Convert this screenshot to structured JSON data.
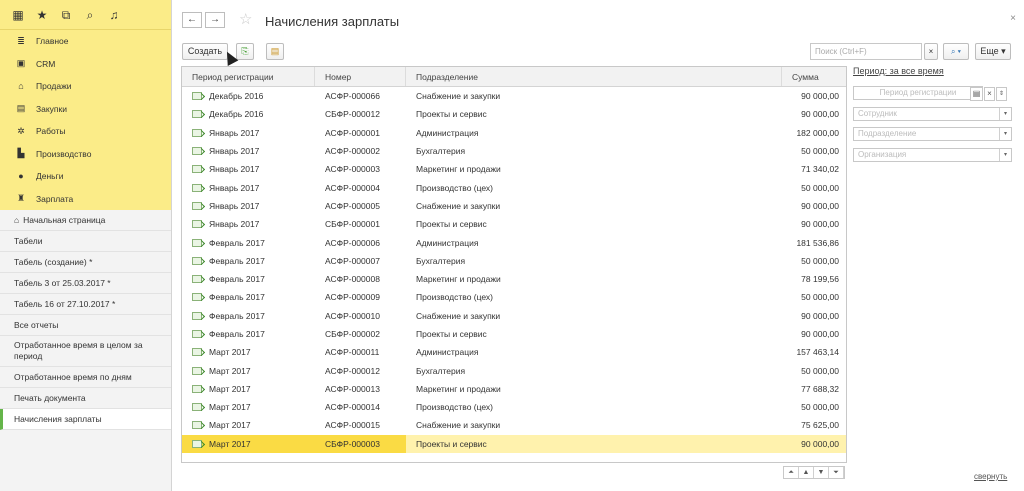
{
  "topbar_icons": [
    "grid-icon",
    "star-icon",
    "history-icon",
    "search-icon",
    "bell-icon"
  ],
  "sections": [
    {
      "label": "Главное",
      "icon": "menu-icon",
      "glyph": "≣"
    },
    {
      "label": "CRM",
      "icon": "crm-icon",
      "glyph": "▣"
    },
    {
      "label": "Продажи",
      "icon": "sales-icon",
      "glyph": "⌂"
    },
    {
      "label": "Закупки",
      "icon": "purchases-icon",
      "glyph": "▤"
    },
    {
      "label": "Работы",
      "icon": "works-icon",
      "glyph": "✲"
    },
    {
      "label": "Производство",
      "icon": "production-icon",
      "glyph": "▙"
    },
    {
      "label": "Деньги",
      "icon": "money-icon",
      "glyph": "●"
    },
    {
      "label": "Зарплата",
      "icon": "salary-icon",
      "glyph": "♜"
    }
  ],
  "open_items": [
    "Начальная страница",
    "Табели",
    "Табель (создание) *",
    "Табель 3 от 25.03.2017 *",
    "Табель 16 от 27.10.2017 *",
    "Все отчеты",
    "Отработанное время в целом за период",
    "Отработанное время по дням",
    "Печать документа",
    "Начисления зарплаты"
  ],
  "header": {
    "title": "Начисления зарплаты",
    "back": "←",
    "forward": "→",
    "close": "×"
  },
  "toolbar": {
    "create_label": "Создать",
    "search_placeholder": "Поиск (Ctrl+F)",
    "more_label": "Еще ▾"
  },
  "table": {
    "columns": [
      "Период регистрации",
      "Номер",
      "Подразделение",
      "Сумма"
    ],
    "rows": [
      [
        "Декабрь 2016",
        "АСФР-000066",
        "Снабжение и закупки",
        "90 000,00"
      ],
      [
        "Декабрь 2016",
        "СБФР-000012",
        "Проекты и сервис",
        "90 000,00"
      ],
      [
        "Январь 2017",
        "АСФР-000001",
        "Администрация",
        "182 000,00"
      ],
      [
        "Январь 2017",
        "АСФР-000002",
        "Бухгалтерия",
        "50 000,00"
      ],
      [
        "Январь 2017",
        "АСФР-000003",
        "Маркетинг и продажи",
        "71 340,02"
      ],
      [
        "Январь 2017",
        "АСФР-000004",
        "Производство (цех)",
        "50 000,00"
      ],
      [
        "Январь 2017",
        "АСФР-000005",
        "Снабжение и закупки",
        "90 000,00"
      ],
      [
        "Январь 2017",
        "СБФР-000001",
        "Проекты и сервис",
        "90 000,00"
      ],
      [
        "Февраль 2017",
        "АСФР-000006",
        "Администрация",
        "181 536,86"
      ],
      [
        "Февраль 2017",
        "АСФР-000007",
        "Бухгалтерия",
        "50 000,00"
      ],
      [
        "Февраль 2017",
        "АСФР-000008",
        "Маркетинг и продажи",
        "78 199,56"
      ],
      [
        "Февраль 2017",
        "АСФР-000009",
        "Производство (цех)",
        "50 000,00"
      ],
      [
        "Февраль 2017",
        "АСФР-000010",
        "Снабжение и закупки",
        "90 000,00"
      ],
      [
        "Февраль 2017",
        "СБФР-000002",
        "Проекты и сервис",
        "90 000,00"
      ],
      [
        "Март 2017",
        "АСФР-000011",
        "Администрация",
        "157 463,14"
      ],
      [
        "Март 2017",
        "АСФР-000012",
        "Бухгалтерия",
        "50 000,00"
      ],
      [
        "Март 2017",
        "АСФР-000013",
        "Маркетинг и продажи",
        "77 688,32"
      ],
      [
        "Март 2017",
        "АСФР-000014",
        "Производство (цех)",
        "50 000,00"
      ],
      [
        "Март 2017",
        "АСФР-000015",
        "Снабжение и закупки",
        "75 625,00"
      ],
      [
        "Март 2017",
        "СБФР-000003",
        "Проекты и сервис",
        "90 000,00"
      ]
    ],
    "selected_row": 19
  },
  "filters": {
    "period_label": "Период: за все время",
    "period_placeholder": "Период регистрации",
    "employee_placeholder": "Сотрудник",
    "department_placeholder": "Подразделение",
    "organization_placeholder": "Организация"
  },
  "pager": [
    "⏶",
    "▲",
    "▼",
    "⏷"
  ],
  "collapse_label": "свернуть",
  "colors": {
    "accent_yellow": "#fbec88",
    "selected_row": "#fadb44",
    "active_marker": "#65b54a"
  }
}
